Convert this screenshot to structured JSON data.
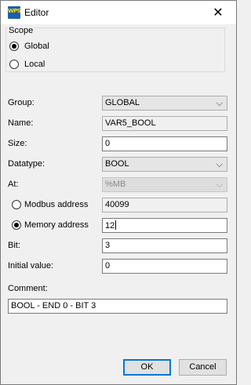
{
  "window": {
    "title": "Editor",
    "app_icon_text": "WPS",
    "close_glyph": "✕"
  },
  "scope": {
    "legend": "Scope",
    "options": [
      {
        "label": "Global",
        "checked": true
      },
      {
        "label": "Local",
        "checked": false
      }
    ]
  },
  "form": {
    "group_label": "Group:",
    "group_value": "GLOBAL",
    "name_label": "Name:",
    "name_value": "VAR5_BOOL",
    "size_label": "Size:",
    "size_value": "0",
    "datatype_label": "Datatype:",
    "datatype_value": "BOOL",
    "at_label": "At:",
    "at_value": "%MB",
    "modbus_label": "Modbus address",
    "modbus_value": "40099",
    "modbus_checked": false,
    "memory_label": "Memory address",
    "memory_value": "12",
    "memory_checked": true,
    "bit_label": "Bit:",
    "bit_value": "3",
    "initial_label": "Initial value:",
    "initial_value": "0",
    "comment_label": "Comment:",
    "comment_value": "BOOL - END 0 - BIT 3"
  },
  "buttons": {
    "ok": "OK",
    "cancel": "Cancel"
  },
  "icons": {
    "dropdown": "chevron-down-icon",
    "close": "close-icon",
    "app": "wps-app-icon"
  }
}
